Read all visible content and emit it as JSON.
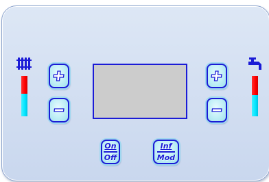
{
  "panel": {
    "heating": {
      "icon": "radiator-icon",
      "level_indicator": {
        "colors": [
          "#ff0000",
          "#00e5ff"
        ]
      },
      "plus_label": "+",
      "minus_label": "−"
    },
    "hot_water": {
      "icon": "faucet-icon",
      "level_indicator": {
        "colors": [
          "#ff0000",
          "#00e5ff"
        ]
      },
      "plus_label": "+",
      "minus_label": "−"
    },
    "display": {
      "text": ""
    },
    "buttons": {
      "on_off": {
        "top": "On",
        "bottom": "Off"
      },
      "inf_mod": {
        "top": "Inf",
        "bottom": "Mod"
      }
    }
  },
  "colors": {
    "accent": "#1b1bd6",
    "button_fill": "#bfeef6",
    "panel_bg": "#d3dff1",
    "display_bg": "#cccccc"
  }
}
